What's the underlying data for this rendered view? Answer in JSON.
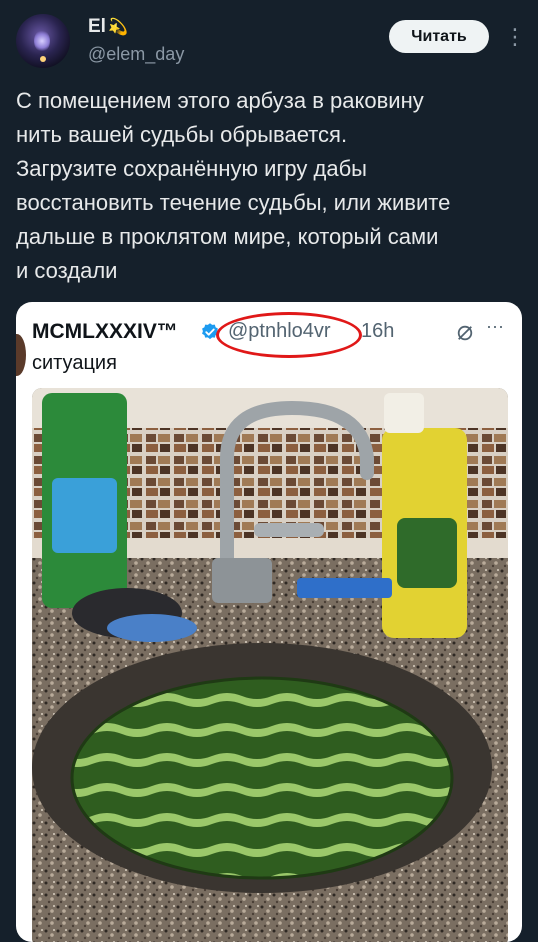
{
  "author": {
    "name": "El",
    "emoji": "💫",
    "handle": "@elem_day"
  },
  "follow_label": "Читать",
  "more_icon": "⋮",
  "tweet_text": "С помещением этого арбуза в раковину\nнить вашей судьбы  обрывается.\nЗагрузите сохранённую игру дабы\nвосстановить течение судьбы, или живите\nдальше в проклятом мире, который сами\nи создали",
  "quoted": {
    "name": "MCMLXXXIV™",
    "handle": "@ptnhlo4vr",
    "time": "16h",
    "more": "···",
    "text": "ситуация"
  },
  "colors": {
    "background": "#15202b",
    "verified": "#1d9bf0",
    "annotation_circle": "#e01818"
  }
}
